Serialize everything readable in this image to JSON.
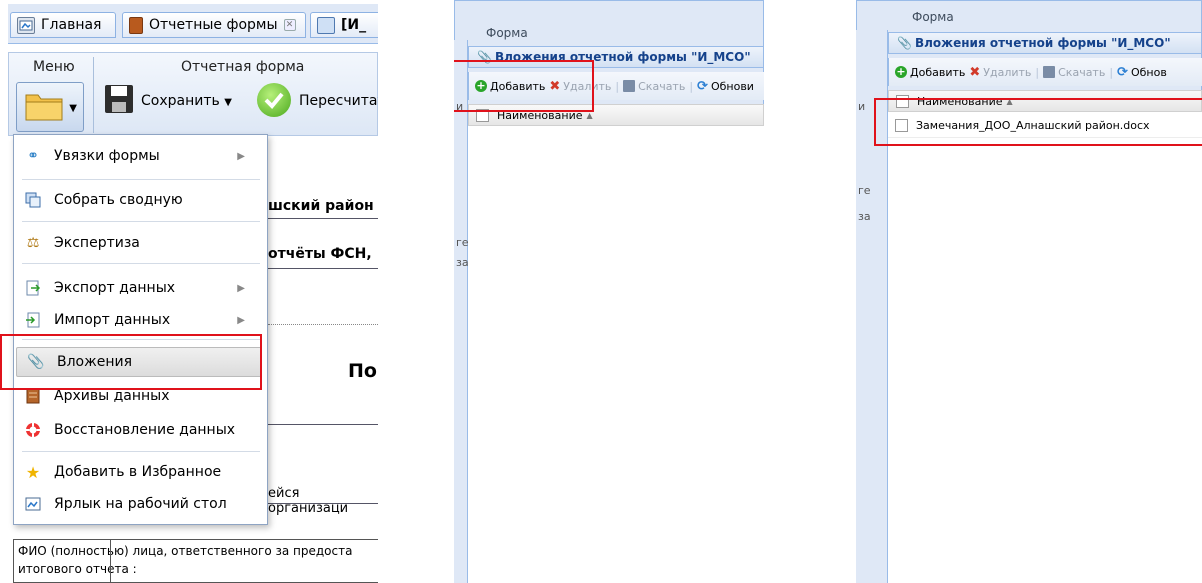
{
  "panel1": {
    "tabs": [
      {
        "label": "Главная"
      },
      {
        "label": "Отчетные формы"
      },
      {
        "label": "[И_"
      }
    ],
    "ribbon": {
      "menu_group": "Меню",
      "report_group": "Отчетная форма",
      "save_label": "Сохранить",
      "recalc_label": "Пересчитат"
    },
    "menu_items": [
      {
        "label": "Увязки формы"
      },
      {
        "label": "Собрать сводную"
      },
      {
        "label": "Экспертиза"
      },
      {
        "label": "Экспорт данных"
      },
      {
        "label": "Импорт данных"
      },
      {
        "label": "Вложения"
      },
      {
        "label": "Архивы данных"
      },
      {
        "label": "Восстановление данных"
      },
      {
        "label": "Добавить в Избранное"
      },
      {
        "label": "Ярлык на рабочий стол"
      }
    ],
    "background": {
      "district": "шский район",
      "reports": "отчёты ФСН,",
      "heading": "По",
      "org": "ейся организаци",
      "fio_line1": "ФИО (полностью) лица, ответственного за предоста",
      "fio_line2": "итогового отчета :"
    }
  },
  "panel2": {
    "form_label": "Форма",
    "title": "Вложения отчетной формы \"И_МСО\"",
    "toolbar": {
      "add": "Добавить",
      "delete": "Удалить",
      "download": "Скачать",
      "refresh": "Обнови"
    },
    "column_name": "Наименование"
  },
  "panel3": {
    "form_label": "Форма",
    "title": "Вложения отчетной формы \"И_МСО\"",
    "toolbar": {
      "add": "Добавить",
      "delete": "Удалить",
      "download": "Скачать",
      "refresh": "Обнов"
    },
    "column_name": "Наименование",
    "rows": [
      {
        "name": "Замечания_ДОО_Алнашский район.docx"
      }
    ]
  }
}
